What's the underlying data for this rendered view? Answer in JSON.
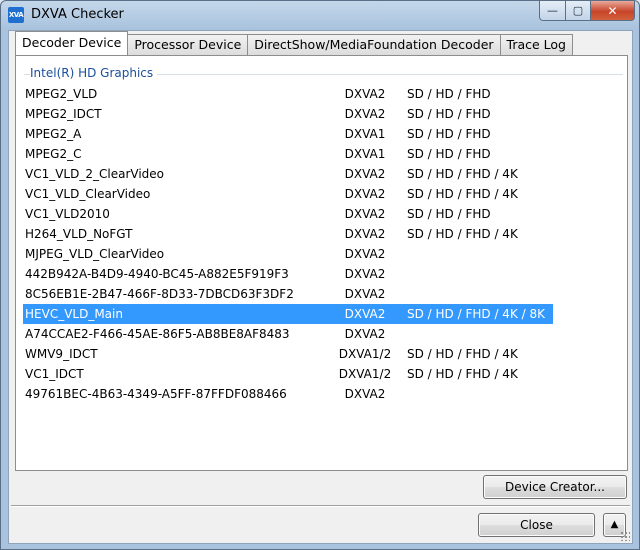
{
  "window": {
    "title": "DXVA Checker",
    "icon_text": "XVA"
  },
  "tabs": [
    {
      "label": "Decoder Device",
      "active": true
    },
    {
      "label": "Processor Device",
      "active": false
    },
    {
      "label": "DirectShow/MediaFoundation Decoder",
      "active": false
    },
    {
      "label": "Trace Log",
      "active": false
    }
  ],
  "group": {
    "title": "Intel(R) HD Graphics"
  },
  "decoders": [
    {
      "name": "MPEG2_VLD",
      "api": "DXVA2",
      "res": "SD / HD / FHD"
    },
    {
      "name": "MPEG2_IDCT",
      "api": "DXVA2",
      "res": "SD / HD / FHD"
    },
    {
      "name": "MPEG2_A",
      "api": "DXVA1",
      "res": "SD / HD / FHD"
    },
    {
      "name": "MPEG2_C",
      "api": "DXVA1",
      "res": "SD / HD / FHD"
    },
    {
      "name": "VC1_VLD_2_ClearVideo",
      "api": "DXVA2",
      "res": "SD / HD / FHD / 4K"
    },
    {
      "name": "VC1_VLD_ClearVideo",
      "api": "DXVA2",
      "res": "SD / HD / FHD / 4K"
    },
    {
      "name": "VC1_VLD2010",
      "api": "DXVA2",
      "res": "SD / HD / FHD"
    },
    {
      "name": "H264_VLD_NoFGT",
      "api": "DXVA2",
      "res": "SD / HD / FHD / 4K"
    },
    {
      "name": "MJPEG_VLD_ClearVideo",
      "api": "DXVA2",
      "res": ""
    },
    {
      "name": "442B942A-B4D9-4940-BC45-A882E5F919F3",
      "api": "DXVA2",
      "res": ""
    },
    {
      "name": "8C56EB1E-2B47-466F-8D33-7DBCD63F3DF2",
      "api": "DXVA2",
      "res": ""
    },
    {
      "name": "HEVC_VLD_Main",
      "api": "DXVA2",
      "res": "SD / HD / FHD / 4K / 8K",
      "selected": true
    },
    {
      "name": "A74CCAE2-F466-45AE-86F5-AB8BE8AF8483",
      "api": "DXVA2",
      "res": ""
    },
    {
      "name": "WMV9_IDCT",
      "api": "DXVA1/2",
      "res": "SD / HD / FHD / 4K"
    },
    {
      "name": "VC1_IDCT",
      "api": "DXVA1/2",
      "res": "SD / HD / FHD / 4K"
    },
    {
      "name": "49761BEC-4B63-4349-A5FF-87FFDF088466",
      "api": "DXVA2",
      "res": ""
    }
  ],
  "buttons": {
    "device_creator": "Device Creator...",
    "close": "Close",
    "expand_arrow": "▲"
  },
  "caption": {
    "minimize": "—",
    "maximize": "▢",
    "close": "✕"
  },
  "colors": {
    "selection": "#3399ff",
    "group_title": "#1a4f9c"
  }
}
